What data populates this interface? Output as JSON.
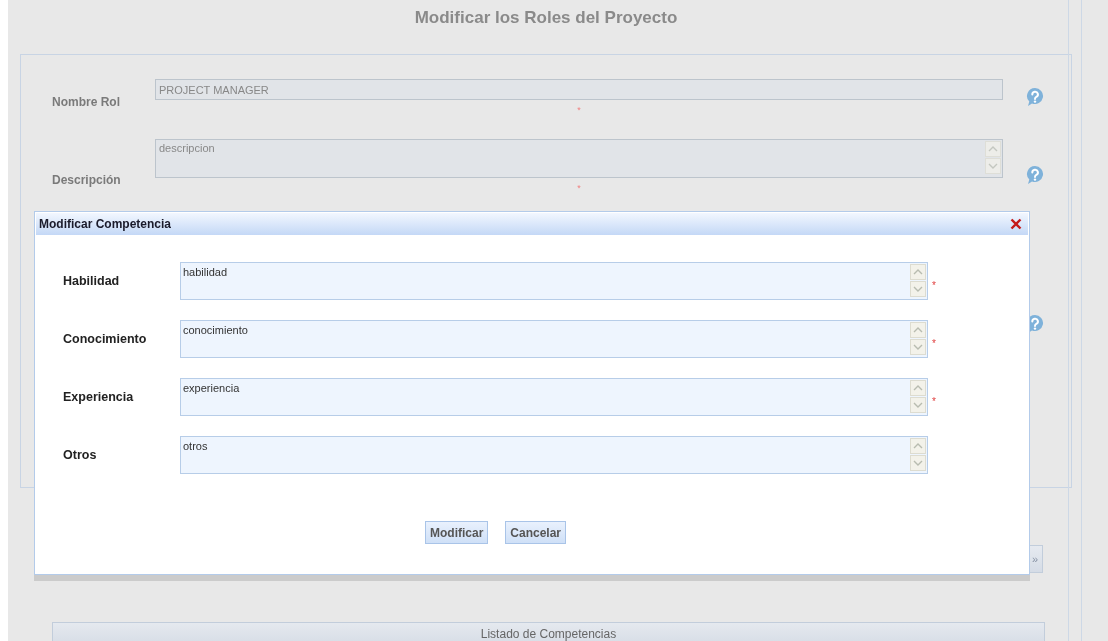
{
  "page": {
    "title": "Modificar los Roles del Proyecto",
    "fields": [
      {
        "kind": "input",
        "label": "Nombre Rol",
        "value": "PROJECT MANAGER",
        "mark": "*",
        "disabled": true
      },
      {
        "kind": "textarea",
        "label": "Descripción",
        "value": "descripcion",
        "mark": "*",
        "disabled": true
      }
    ],
    "next_button": "»",
    "list_header": "Listado de Competencias"
  },
  "dialog": {
    "title": "Modificar Competencia",
    "fields": [
      {
        "label": "Habilidad",
        "value": "habilidad",
        "mark": "*"
      },
      {
        "label": "Conocimiento",
        "value": "conocimiento",
        "mark": "*"
      },
      {
        "label": "Experiencia",
        "value": "experiencia",
        "mark": "*"
      },
      {
        "label": "Otros",
        "value": "otros"
      }
    ],
    "buttons": [
      "Modificar",
      "Cancelar"
    ]
  }
}
